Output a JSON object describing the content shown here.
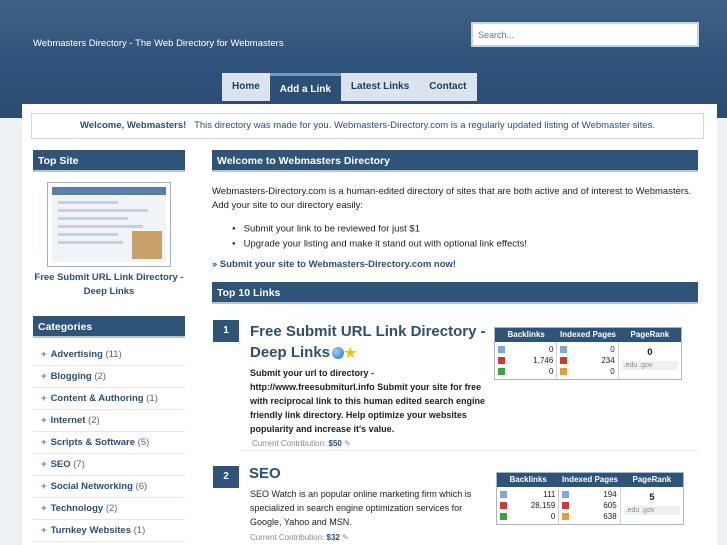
{
  "header": {
    "site_title": "Webmasters Directory - The Web Directory for Webmasters",
    "search_placeholder": "Search..."
  },
  "nav": {
    "items": [
      {
        "label": "Home",
        "active": false
      },
      {
        "label": "Add a Link",
        "active": true
      },
      {
        "label": "Latest Links",
        "active": false
      },
      {
        "label": "Contact",
        "active": false
      }
    ]
  },
  "welcome": {
    "greeting": "Welcome, Webmasters!",
    "text": "This directory was made for you. Webmasters-Directory.com is a regularly updated listing of Webmaster sites."
  },
  "sidebar": {
    "top_site_heading": "Top Site",
    "top_site_title": "Free Submit URL Link Directory - Deep Links",
    "categories_heading": "Categories",
    "categories": [
      {
        "name": "Advertising",
        "count": "(11)"
      },
      {
        "name": "Blogging",
        "count": "(2)"
      },
      {
        "name": "Content & Authoring",
        "count": "(1)"
      },
      {
        "name": "Internet",
        "count": "(2)"
      },
      {
        "name": "Scripts & Software",
        "count": "(5)"
      },
      {
        "name": "SEO",
        "count": "(7)"
      },
      {
        "name": "Social Networking",
        "count": "(6)"
      },
      {
        "name": "Technology",
        "count": "(2)"
      },
      {
        "name": "Turnkey Websites",
        "count": "(1)"
      }
    ]
  },
  "main": {
    "welcome_heading": "Welcome to Webmasters Directory",
    "intro": "Webmasters-Directory.com is a human-edited directory of sites that are both active and of interest to Webmasters. Add your site to our directory easily:",
    "bullets": [
      "Submit your link to be reviewed for just $1",
      "Upgrade your listing and make it stand out with optional link effects!"
    ],
    "submit_link": "» Submit your site to Webmasters-Directory.com now!",
    "top_links_heading": "Top 10 Links",
    "stats_headers": {
      "backlinks": "Backlinks",
      "indexed": "Indexed Pages",
      "pagerank": "PageRank"
    },
    "links": [
      {
        "rank": "1",
        "title": "Free Submit URL Link Directory - Deep Links",
        "description": "Submit your url to directory - http://www.freesubmiturl.info Submit your site for free with reciprocal link to this human edited search engine friendly link directory. Help optimize your websites popularity and increase it's value.",
        "contribution_label": "Current Contribution:",
        "contribution_value": "$50",
        "backlinks": [
          "0",
          "1,746",
          "0"
        ],
        "indexed": [
          "0",
          "234",
          "0"
        ],
        "pagerank": "0",
        "edu_gov": ".edu  .gov"
      },
      {
        "rank": "2",
        "title": "SEO",
        "description": "SEO Watch is an popular online marketing firm which is specialized in search engine optimization services for Google, Yahoo and MSN.",
        "contribution_label": "Current Contribution:",
        "contribution_value": "$32",
        "backlinks": [
          "111",
          "28,159",
          "0"
        ],
        "indexed": [
          "194",
          "605",
          "638"
        ],
        "pagerank": "5",
        "edu_gov": ".edu  .gov"
      }
    ]
  },
  "colors": {
    "header": "#2e5279",
    "accent": "#2c4f75",
    "panel": "#2e5479"
  }
}
